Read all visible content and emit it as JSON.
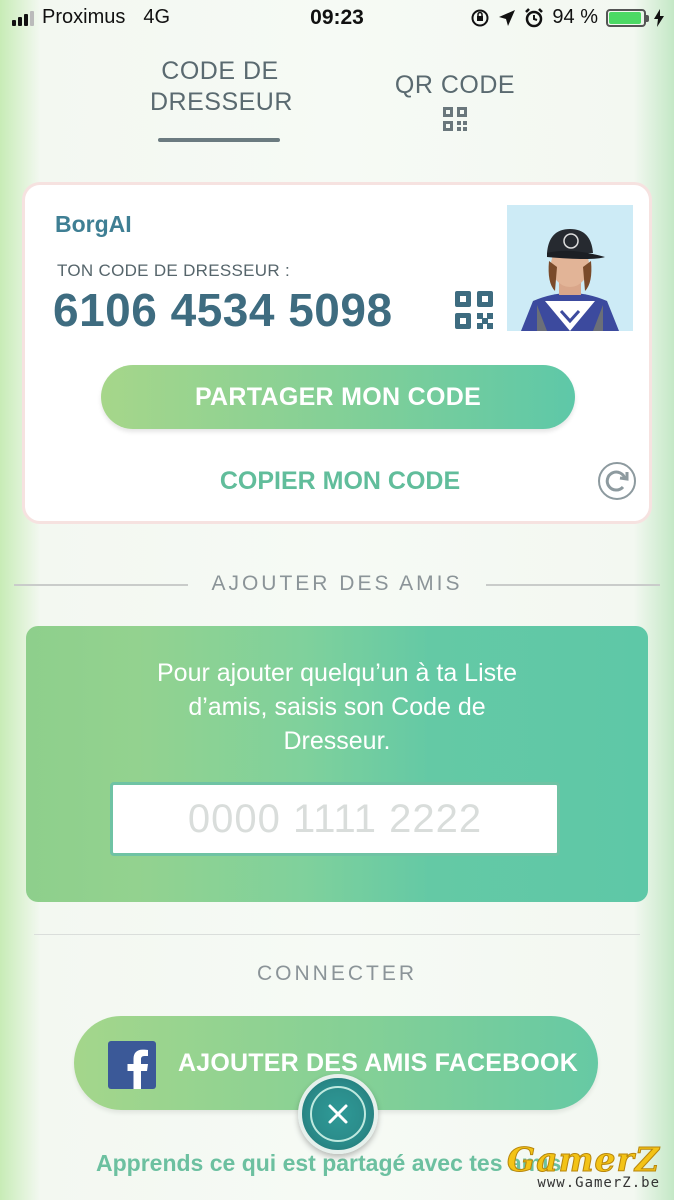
{
  "status_bar": {
    "carrier": "Proximus",
    "network": "4G",
    "time": "09:23",
    "battery_percent": "94 %",
    "battery_level": 0.94
  },
  "tabs": [
    {
      "label_line1": "CODE DE",
      "label_line2": "DRESSEUR",
      "active": true
    },
    {
      "label": "QR CODE",
      "icon": "qr-code-icon"
    }
  ],
  "trainer_card": {
    "name": "BorgAI",
    "code_label": "TON CODE DE DRESSEUR :",
    "code": "6106 4534 5098",
    "share_button": "PARTAGER MON CODE",
    "copy_link": "COPIER MON CODE"
  },
  "add_friends": {
    "section_title": "AJOUTER DES AMIS",
    "instruction_line1": "Pour ajouter quelqu’un à ta Liste",
    "instruction_line2": "d’amis, saisis son Code de",
    "instruction_line3": "Dresseur.",
    "input_placeholder": "0000 1111 2222"
  },
  "connect": {
    "section_title": "CONNECTER",
    "facebook_button": "AJOUTER DES AMIS FACEBOOK",
    "learn_link": "Apprends ce qui est partagé avec tes amis"
  },
  "watermark": {
    "logo": "GamerZ",
    "url": "www.GamerZ.be"
  },
  "colors": {
    "accent_teal": "#61bd9b",
    "code_blue": "#3e6c80",
    "facebook_blue": "#3b5998"
  }
}
